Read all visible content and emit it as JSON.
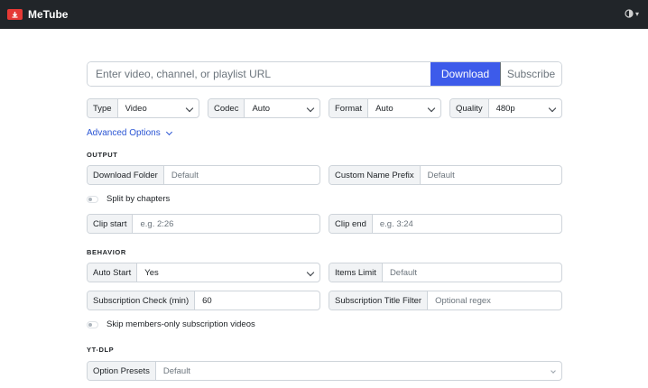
{
  "app": {
    "title": "MeTube"
  },
  "url_bar": {
    "placeholder": "Enter video, channel, or playlist URL",
    "download_label": "Download",
    "subscribe_label": "Subscribe"
  },
  "filters": [
    {
      "label": "Type",
      "value": "Video"
    },
    {
      "label": "Codec",
      "value": "Auto"
    },
    {
      "label": "Format",
      "value": "Auto"
    },
    {
      "label": "Quality",
      "value": "480p"
    }
  ],
  "advanced_options_label": "Advanced Options",
  "output": {
    "heading": "OUTPUT",
    "download_folder": {
      "label": "Download Folder",
      "placeholder": "Default"
    },
    "custom_name_prefix": {
      "label": "Custom Name Prefix",
      "placeholder": "Default"
    },
    "split_by_chapters": {
      "label": "Split by chapters",
      "checked": false
    },
    "clip_start": {
      "label": "Clip start",
      "placeholder": "e.g. 2:26"
    },
    "clip_end": {
      "label": "Clip end",
      "placeholder": "e.g. 3:24"
    }
  },
  "behavior": {
    "heading": "BEHAVIOR",
    "auto_start": {
      "label": "Auto Start",
      "value": "Yes"
    },
    "items_limit": {
      "label": "Items Limit",
      "placeholder": "Default"
    },
    "subscription_check": {
      "label": "Subscription Check (min)",
      "value": "60"
    },
    "subscription_title_filter": {
      "label": "Subscription Title Filter",
      "placeholder": "Optional regex"
    },
    "skip_members_only": {
      "label": "Skip members-only subscription videos",
      "checked": false
    }
  },
  "ytdlp": {
    "heading": "YT-DLP",
    "option_presets": {
      "label": "Option Presets",
      "placeholder": "Default"
    }
  },
  "colors": {
    "navbar": "#212529",
    "accent": "#3d5bea",
    "link": "#2a55d4",
    "logo": "#e53935"
  }
}
